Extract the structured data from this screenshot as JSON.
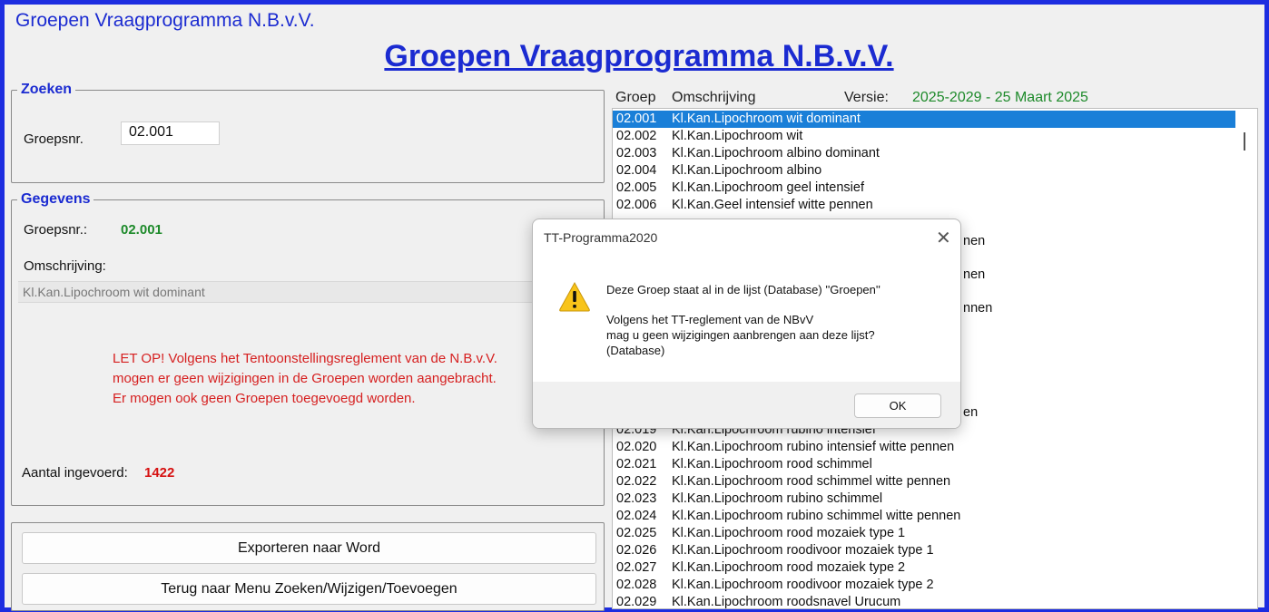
{
  "window": {
    "title": "Groepen Vraagprogramma N.B.v.V."
  },
  "main_title": "Groepen Vraagprogramma N.B.v.V.",
  "search": {
    "legend": "Zoeken",
    "label": "Groepsnr.",
    "value": "02.001"
  },
  "details": {
    "legend": "Gegevens",
    "nr_label": "Groepsnr.:",
    "nr_value": "02.001",
    "desc_label": "Omschrijving:",
    "desc_value": "Kl.Kan.Lipochroom wit dominant",
    "warning": [
      "LET OP! Volgens het Tentoonstellingsreglement van de N.B.v.V.",
      "mogen er geen wijzigingen in de Groepen worden aangebracht.",
      "Er mogen ook geen Groepen toegevoegd worden."
    ],
    "count_label": "Aantal ingevoerd:",
    "count_value": "1422"
  },
  "buttons": {
    "export": "Exporteren naar Word",
    "back": "Terug naar Menu Zoeken/Wijzigen/Toevoegen"
  },
  "list": {
    "col_group": "Groep",
    "col_desc": "Omschrijving",
    "version_label": "Versie:",
    "version_value": "2025-2029 - 25 Maart 2025",
    "rows": [
      {
        "code": "02.001",
        "desc": "Kl.Kan.Lipochroom wit dominant"
      },
      {
        "code": "02.002",
        "desc": "Kl.Kan.Lipochroom wit"
      },
      {
        "code": "02.003",
        "desc": "Kl.Kan.Lipochroom albino dominant"
      },
      {
        "code": "02.004",
        "desc": "Kl.Kan.Lipochroom albino"
      },
      {
        "code": "02.005",
        "desc": "Kl.Kan.Lipochroom geel intensief"
      },
      {
        "code": "02.006",
        "desc": "Kl.Kan.Geel intensief witte pennen"
      },
      {
        "code": "02.019",
        "desc": "Kl.Kan.Lipochroom rubino intensief"
      },
      {
        "code": "02.020",
        "desc": "Kl.Kan.Lipochroom rubino intensief witte pennen"
      },
      {
        "code": "02.021",
        "desc": "Kl.Kan.Lipochroom rood schimmel"
      },
      {
        "code": "02.022",
        "desc": "Kl.Kan.Lipochroom rood schimmel witte pennen"
      },
      {
        "code": "02.023",
        "desc": "Kl.Kan.Lipochroom rubino schimmel"
      },
      {
        "code": "02.024",
        "desc": "Kl.Kan.Lipochroom rubino schimmel witte pennen"
      },
      {
        "code": "02.025",
        "desc": "Kl.Kan.Lipochroom rood mozaiek type 1"
      },
      {
        "code": "02.026",
        "desc": "Kl.Kan.Lipochroom roodivoor mozaiek type 1"
      },
      {
        "code": "02.027",
        "desc": "Kl.Kan.Lipochroom rood mozaiek type 2"
      },
      {
        "code": "02.028",
        "desc": "Kl.Kan.Lipochroom roodivoor mozaiek type 2"
      },
      {
        "code": "02.029",
        "desc": "Kl.Kan.Lipochroom roodsnavel Urucum"
      }
    ],
    "partial_fragments": [
      "nen",
      "nen",
      "nnen",
      "en"
    ]
  },
  "dialog": {
    "title": "TT-Programma2020",
    "icon": "warning-icon",
    "line1": "Deze Groep staat al in de lijst (Database) ''Groepen''",
    "line2": "Volgens het TT-reglement van de NBvV",
    "line3": "mag u geen wijzigingen aanbrengen aan deze lijst?",
    "line4": "(Database)",
    "ok": "OK"
  },
  "colors": {
    "frame": "#1d2de0",
    "title": "#1b2bd1",
    "selection": "#1a7fd8",
    "green": "#1d8a2a",
    "red": "#d62020"
  }
}
